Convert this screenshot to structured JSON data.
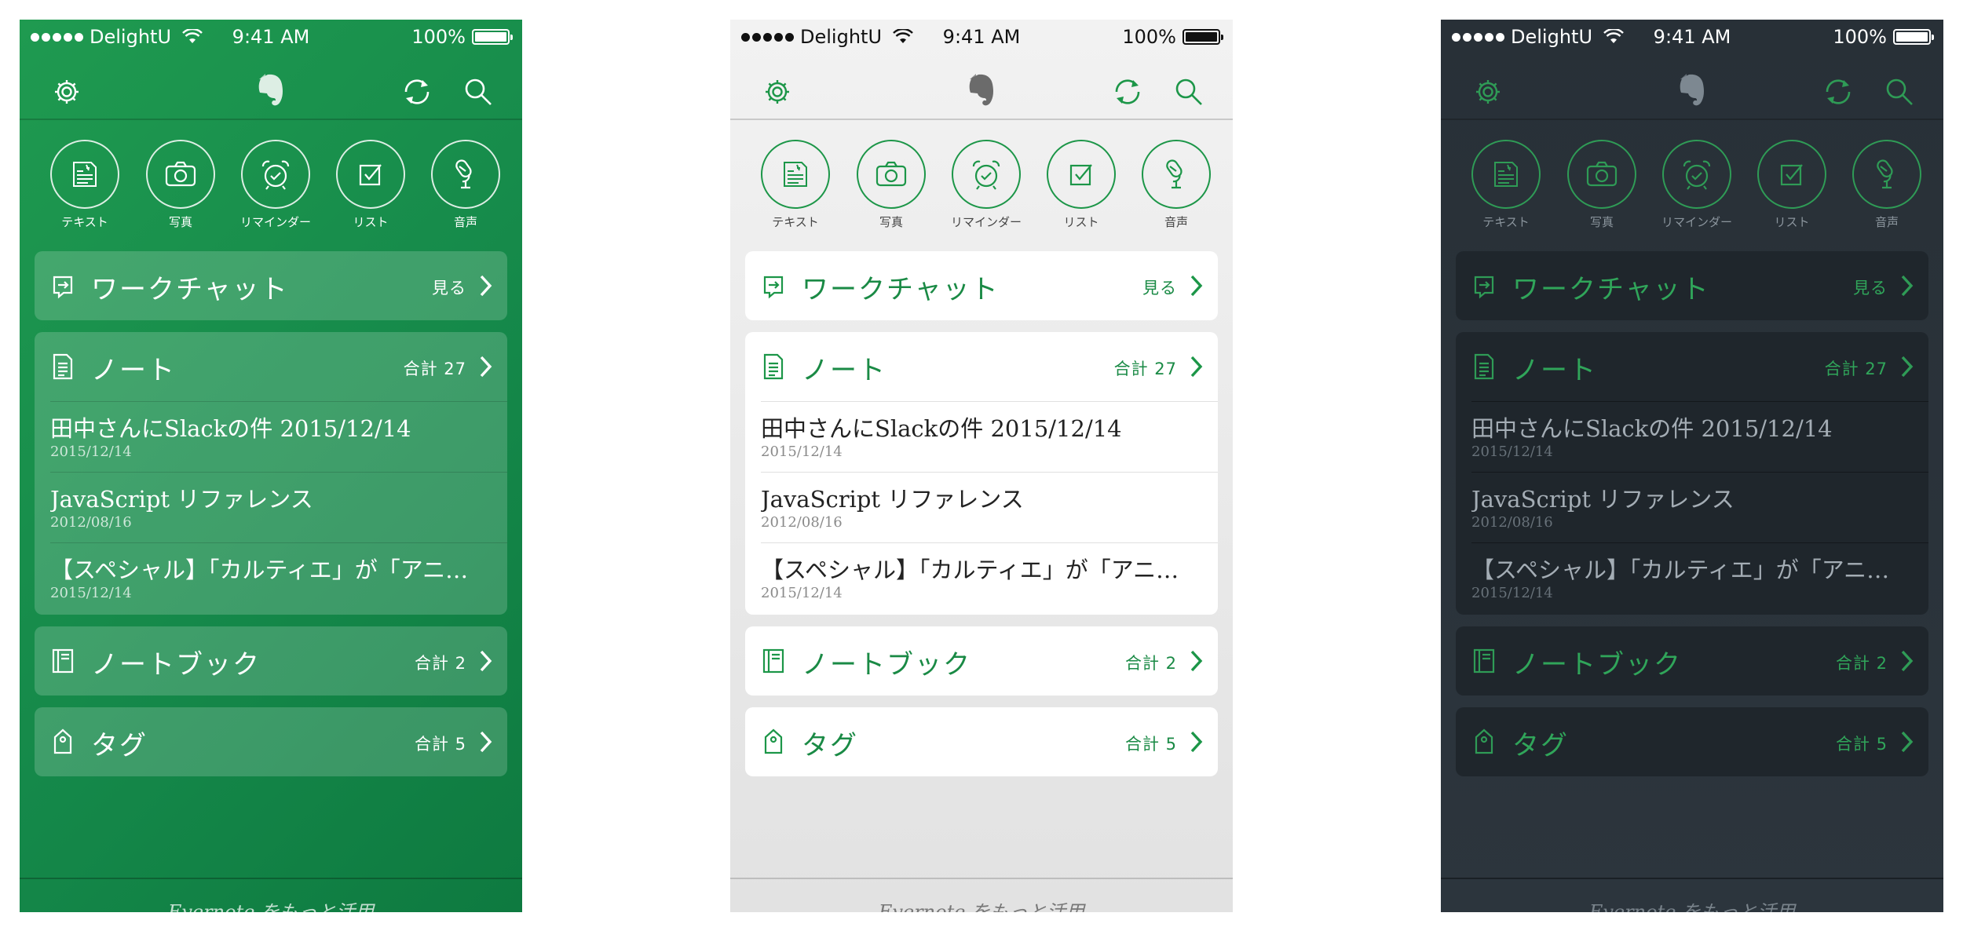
{
  "colors": {
    "green_theme_bg": "#15894a",
    "light_theme_bg": "#ebebeb",
    "dark_theme_bg": "#2a333b",
    "accent_green": "#1c9648"
  },
  "status_bar": {
    "carrier": "DelightU",
    "time": "9:41 AM",
    "battery": "100%"
  },
  "nav": {
    "left_icon": "gear-icon",
    "center_icon": "evernote-elephant-logo",
    "right_icons": [
      "sync-icon",
      "search-icon"
    ]
  },
  "quick_actions": [
    {
      "label": "テキスト",
      "icon": "text-note-icon"
    },
    {
      "label": "写真",
      "icon": "camera-icon"
    },
    {
      "label": "リマインダー",
      "icon": "alarm-clock-icon"
    },
    {
      "label": "リスト",
      "icon": "checkbox-icon"
    },
    {
      "label": "音声",
      "icon": "microphone-icon"
    }
  ],
  "workchat": {
    "title": "ワークチャット",
    "meta": "見る",
    "icon": "workchat-icon"
  },
  "notes_section": {
    "title": "ノート",
    "meta": "合計 27",
    "icon": "note-icon"
  },
  "notes": [
    {
      "title": "田中さんにSlackの件 2015/12/14",
      "date": "2015/12/14"
    },
    {
      "title": "JavaScript リファレンス",
      "date": "2012/08/16"
    },
    {
      "title": "【スペシャル】「カルティエ」が「アニエス・ベー」",
      "date": "2015/12/14"
    }
  ],
  "notebooks": {
    "title": "ノートブック",
    "meta": "合計 2",
    "icon": "notebook-icon"
  },
  "tags": {
    "title": "タグ",
    "meta": "合計 5",
    "icon": "tag-icon"
  },
  "footer": {
    "text": "Evernote をもっと活用"
  }
}
